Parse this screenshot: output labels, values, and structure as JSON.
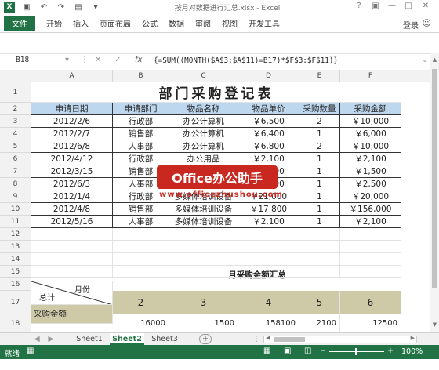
{
  "window": {
    "app_icon": "X",
    "title": "按月对数据进行汇总.xlsx - Excel",
    "controls": [
      "?",
      "▣",
      "—",
      "□",
      "✕"
    ]
  },
  "quick_access": {
    "save_icon": "save-icon",
    "undo_icon": "undo-icon",
    "redo_icon": "redo-icon",
    "customize": "▾"
  },
  "ribbon": {
    "file": "文件",
    "tabs": [
      "开始",
      "插入",
      "页面布局",
      "公式",
      "数据",
      "审阅",
      "视图",
      "开发工具"
    ],
    "login": "登录"
  },
  "formula_bar": {
    "name_box": "B18",
    "fx": "fx",
    "formula": "{=SUM((MONTH($A$3:$A$11)=B17)*$F$3:$F$11)}"
  },
  "columns": [
    "A",
    "B",
    "C",
    "D",
    "E",
    "F"
  ],
  "rows": [
    "1",
    "2",
    "3",
    "4",
    "5",
    "6",
    "7",
    "8",
    "9",
    "10",
    "11",
    "12",
    "13",
    "14",
    "15",
    "16",
    "17",
    "18",
    "19"
  ],
  "sheet": {
    "title": "部门采购登记表",
    "headers": [
      "申请日期",
      "申请部门",
      "物品名称",
      "物品单价",
      "采购数量",
      "采购金额"
    ],
    "records": [
      [
        "2012/2/6",
        "行政部",
        "办公计算机",
        "￥6,500",
        "2",
        "￥10,000"
      ],
      [
        "2012/2/7",
        "销售部",
        "办公计算机",
        "￥6,400",
        "1",
        "￥6,000"
      ],
      [
        "2012/6/8",
        "人事部",
        "办公计算机",
        "￥6,800",
        "2",
        "￥10,000"
      ],
      [
        "2012/4/12",
        "行政部",
        "办公用品",
        "￥2,100",
        "1",
        "￥2,100"
      ],
      [
        "2012/3/15",
        "销售部",
        "办公用品",
        "￥1,500",
        "1",
        "￥1,500"
      ],
      [
        "2012/6/3",
        "人事部",
        "办公用品",
        "￥2,500",
        "1",
        "￥2,500"
      ],
      [
        "2012/1/4",
        "行政部",
        "多媒体培训设备",
        "￥21,000",
        "1",
        "￥20,000"
      ],
      [
        "2012/4/8",
        "销售部",
        "多媒体培训设备",
        "￥17,800",
        "1",
        "￥156,000"
      ],
      [
        "2012/5/16",
        "人事部",
        "多媒体培训设备",
        "￥2,100",
        "1",
        "￥2,100"
      ]
    ],
    "summary_title": "月采购金额汇总",
    "diag_top": "月份",
    "diag_bottom": "总计",
    "months": [
      "2",
      "3",
      "4",
      "5",
      "6"
    ],
    "amount_label": "采购金额",
    "amounts": [
      "16000",
      "1500",
      "158100",
      "2100",
      "12500"
    ]
  },
  "sheet_tabs": [
    "Sheet1",
    "Sheet2",
    "Sheet3"
  ],
  "active_sheet": "Sheet2",
  "status": {
    "left": "就绪",
    "zoom": "100%"
  },
  "watermark": {
    "badge": "Office办公助手",
    "url": "www.officezhushou.com"
  },
  "colors": {
    "excel_green": "#217346",
    "header_blue": "#bdd7ee",
    "summary_tan": "#cec9a6",
    "watermark_red": "#c8281f"
  }
}
